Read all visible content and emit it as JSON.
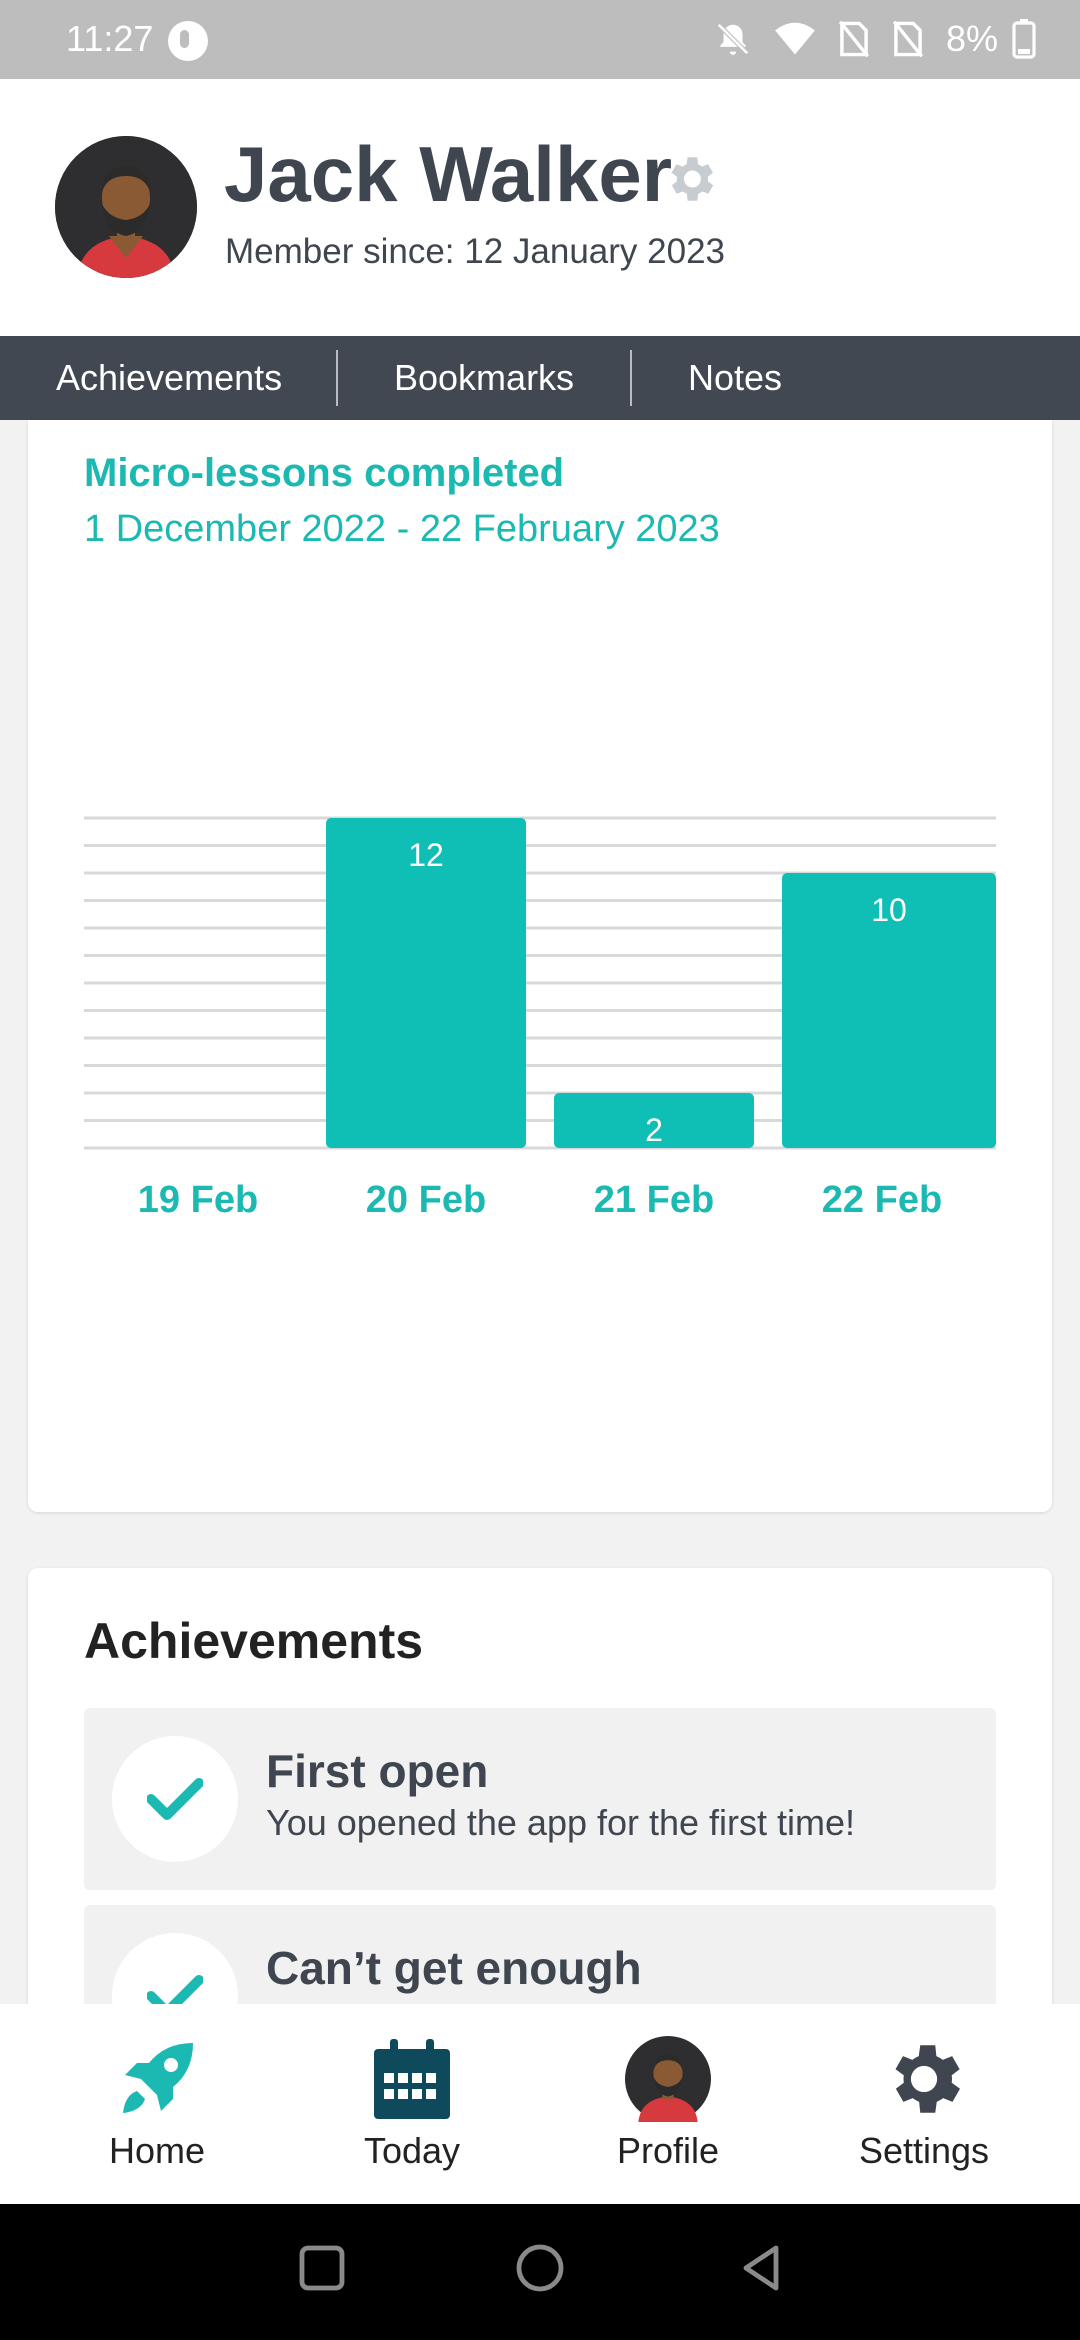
{
  "status_bar": {
    "time": "11:27",
    "battery": "8%"
  },
  "profile": {
    "name": "Jack Walker",
    "member_since": "Member since: 12 January 2023"
  },
  "tabs": [
    {
      "label": "Achievements"
    },
    {
      "label": "Bookmarks"
    },
    {
      "label": "Notes"
    }
  ],
  "chart_data": {
    "type": "bar",
    "title": "Micro-lessons completed",
    "subtitle": "1 December 2022 - 22 February 2023",
    "categories": [
      "19 Feb",
      "20 Feb",
      "21 Feb",
      "22 Feb"
    ],
    "values": [
      0,
      12,
      2,
      10
    ],
    "ylim": [
      0,
      12
    ],
    "grid": true,
    "bar_color": "#0fbfb6"
  },
  "achievements": {
    "heading": "Achievements",
    "items": [
      {
        "title": "First open",
        "description": "You opened the app for the first time!"
      },
      {
        "title": "Can’t get enough",
        "description": ""
      }
    ]
  },
  "bottom_nav": [
    {
      "label": "Home",
      "icon": "rocket-icon"
    },
    {
      "label": "Today",
      "icon": "calendar-icon"
    },
    {
      "label": "Profile",
      "icon": "avatar-icon"
    },
    {
      "label": "Settings",
      "icon": "gear-icon"
    }
  ],
  "colors": {
    "accent": "#1bb9b2",
    "header_dark": "#414852",
    "text_dark": "#3f4650"
  }
}
